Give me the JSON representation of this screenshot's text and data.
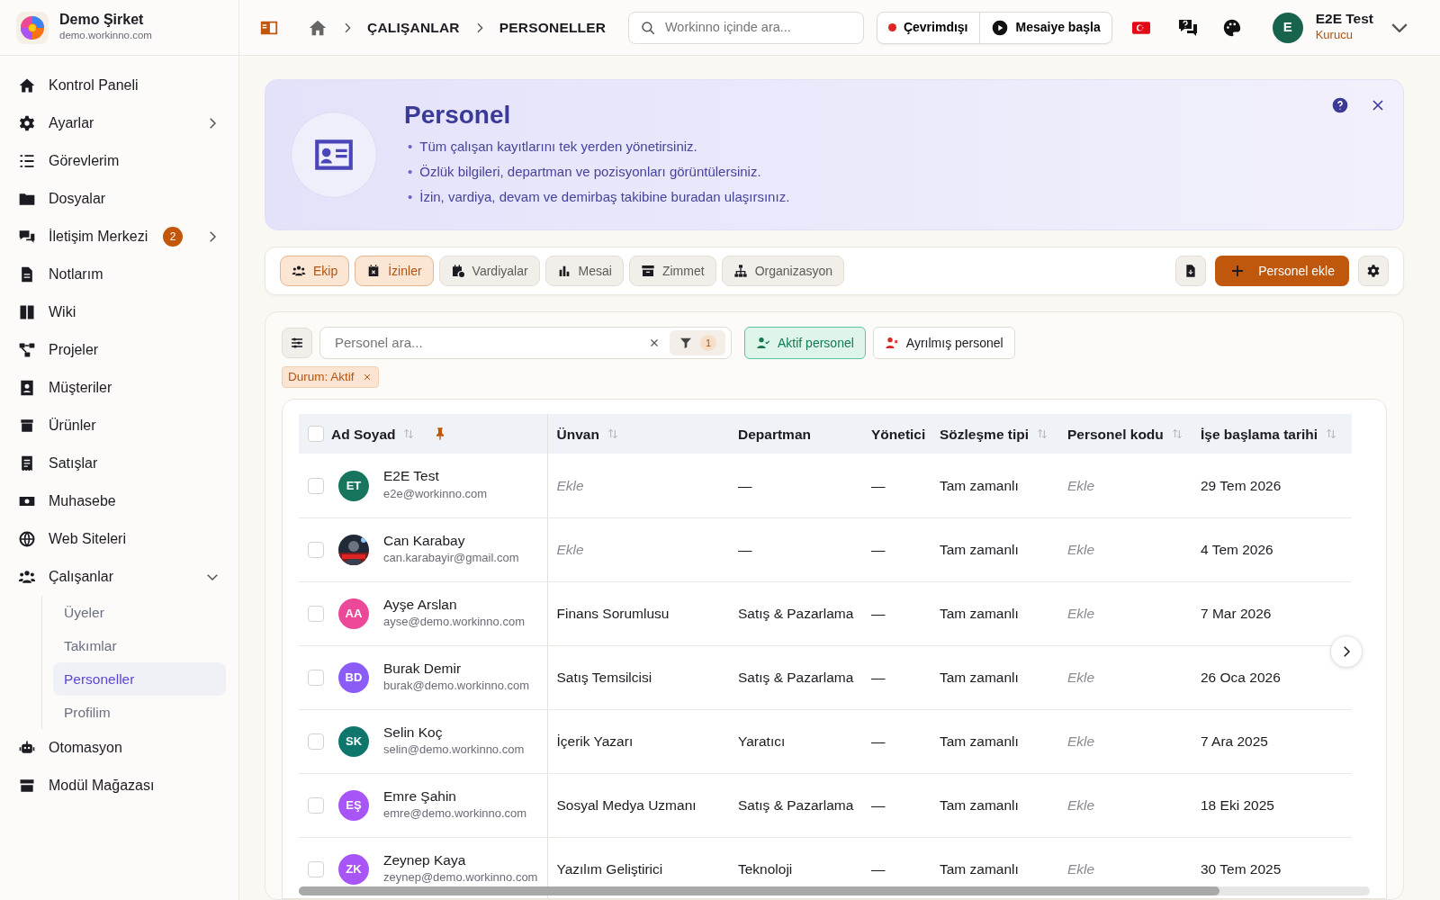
{
  "brand": {
    "name": "Demo Şirket",
    "domain": "demo.workinno.com"
  },
  "header": {
    "breadcrumb": [
      "ÇALIŞANLAR",
      "PERSONELLER"
    ],
    "search": {
      "placeholder": "Workinno içinde ara..."
    },
    "presence": {
      "label": "Çevrimdışı",
      "online": false
    },
    "shift_button": "Mesaiye başla",
    "user": {
      "initial": "E",
      "name": "E2E Test",
      "role": "Kurucu"
    }
  },
  "sidebar": {
    "items": [
      {
        "label": "Kontrol Paneli",
        "kind": "link"
      },
      {
        "label": "Ayarlar",
        "kind": "group",
        "expanded": false
      },
      {
        "label": "Görevlerim",
        "kind": "link"
      },
      {
        "label": "Dosyalar",
        "kind": "link"
      },
      {
        "label": "İletişim Merkezi",
        "kind": "group",
        "expanded": false,
        "badge": "2"
      },
      {
        "label": "Notlarım",
        "kind": "link"
      },
      {
        "label": "Wiki",
        "kind": "link"
      },
      {
        "label": "Projeler",
        "kind": "link"
      },
      {
        "label": "Müşteriler",
        "kind": "link"
      },
      {
        "label": "Ürünler",
        "kind": "link"
      },
      {
        "label": "Satışlar",
        "kind": "link"
      },
      {
        "label": "Muhasebe",
        "kind": "link"
      },
      {
        "label": "Web Siteleri",
        "kind": "link"
      },
      {
        "label": "Çalışanlar",
        "kind": "group",
        "expanded": true,
        "children": [
          {
            "label": "Üyeler",
            "selected": false
          },
          {
            "label": "Takımlar",
            "selected": false
          },
          {
            "label": "Personeller",
            "selected": true
          },
          {
            "label": "Profilim",
            "selected": false
          }
        ]
      },
      {
        "label": "Otomasyon",
        "kind": "link"
      },
      {
        "label": "Modül Mağazası",
        "kind": "link"
      }
    ]
  },
  "info_banner": {
    "title": "Personel",
    "bullets": [
      {
        "marker": "•",
        "text": "Tüm çalışan kayıtlarını tek yerden yönetirsiniz."
      },
      {
        "marker": "•",
        "text": "Özlük bilgileri, departman ve pozisyonları görüntülersiniz."
      },
      {
        "marker": "•",
        "text": "İzin, vardiya, devam ve demirbaş takibine buradan ulaşırsınız."
      }
    ]
  },
  "tabs": [
    {
      "label": "Ekip",
      "selected": true
    },
    {
      "label": "İzinler",
      "selected": true
    },
    {
      "label": "Vardiyalar",
      "selected": false
    },
    {
      "label": "Mesai",
      "selected": false
    },
    {
      "label": "Zimmet",
      "selected": false
    },
    {
      "label": "Organizasyon",
      "selected": false
    }
  ],
  "add_button": "Personel ekle",
  "filters": {
    "search": {
      "placeholder": "Personel ara..."
    },
    "filter_count": "1",
    "status_buttons": [
      {
        "label": "Aktif personel",
        "selected": true
      },
      {
        "label": "Ayrılmış personel",
        "selected": false
      }
    ],
    "chips": [
      "Durum: Aktif"
    ]
  },
  "table": {
    "select_all": {
      "checked": false
    },
    "columns": [
      {
        "label": "Ad Soyad",
        "sortable": true,
        "pinned": true
      },
      {
        "label": "Ünvan",
        "sortable": true,
        "pinned": false
      },
      {
        "label": "Departman",
        "sortable": false,
        "pinned": false
      },
      {
        "label": "Yönetici",
        "sortable": false,
        "pinned": false
      },
      {
        "label": "Sözleşme tipi",
        "sortable": true,
        "pinned": false
      },
      {
        "label": "Personel kodu",
        "sortable": true,
        "pinned": false
      },
      {
        "label": "İşe başlama tarihi",
        "sortable": true,
        "pinned": false
      }
    ],
    "rows": [
      {
        "checked": false,
        "avatar": {
          "kind": "initials",
          "text": "ET",
          "color": "#17745d"
        },
        "name": "E2E Test",
        "email": "e2e@workinno.com",
        "title": {
          "text": "Ekle",
          "empty": true
        },
        "department": "—",
        "manager": "—",
        "contract": "Tam zamanlı",
        "code": {
          "text": "Ekle",
          "empty": true
        },
        "start_date": "29 Tem 2026"
      },
      {
        "checked": false,
        "name": "Can Karabay",
        "email": "can.karabayir@gmail.com",
        "title": {
          "text": "Ekle",
          "empty": true
        },
        "department": "—",
        "manager": "—",
        "contract": "Tam zamanlı",
        "code": {
          "text": "Ekle",
          "empty": true
        },
        "start_date": "4 Tem 2026"
      },
      {
        "checked": false,
        "avatar": {
          "kind": "initials",
          "text": "AA",
          "color": "#ec4899"
        },
        "name": "Ayşe Arslan",
        "email": "ayse@demo.workinno.com",
        "title": {
          "text": "Finans Sorumlusu",
          "empty": false
        },
        "department": "Satış & Pazarlama",
        "manager": "—",
        "contract": "Tam zamanlı",
        "code": {
          "text": "Ekle",
          "empty": true
        },
        "start_date": "7 Mar 2026"
      },
      {
        "checked": false,
        "avatar": {
          "kind": "initials",
          "text": "BD",
          "color": "#8b5cf6"
        },
        "name": "Burak Demir",
        "email": "burak@demo.workinno.com",
        "title": {
          "text": "Satış Temsilcisi",
          "empty": false
        },
        "department": "Satış & Pazarlama",
        "manager": "—",
        "contract": "Tam zamanlı",
        "code": {
          "text": "Ekle",
          "empty": true
        },
        "start_date": "26 Oca 2026"
      },
      {
        "checked": false,
        "avatar": {
          "kind": "initials",
          "text": "SK",
          "color": "#0f766e"
        },
        "name": "Selin Koç",
        "email": "selin@demo.workinno.com",
        "title": {
          "text": "İçerik Yazarı",
          "empty": false
        },
        "department": "Yaratıcı",
        "manager": "—",
        "contract": "Tam zamanlı",
        "code": {
          "text": "Ekle",
          "empty": true
        },
        "start_date": "7 Ara 2025"
      },
      {
        "checked": false,
        "avatar": {
          "kind": "initials",
          "text": "EŞ",
          "color": "#a855f7"
        },
        "name": "Emre Şahin",
        "email": "emre@demo.workinno.com",
        "title": {
          "text": "Sosyal Medya Uzmanı",
          "empty": false
        },
        "department": "Satış & Pazarlama",
        "manager": "—",
        "contract": "Tam zamanlı",
        "code": {
          "text": "Ekle",
          "empty": true
        },
        "start_date": "18 Eki 2025"
      },
      {
        "checked": false,
        "avatar": {
          "kind": "initials",
          "text": "ZK",
          "color": "#a855f7"
        },
        "name": "Zeynep Kaya",
        "email": "zeynep@demo.workinno.com",
        "title": {
          "text": "Yazılım Geliştirici",
          "empty": false
        },
        "department": "Teknoloji",
        "manager": "—",
        "contract": "Tam zamanlı",
        "code": {
          "text": "Ekle",
          "empty": true
        },
        "start_date": "30 Tem 2025"
      }
    ]
  }
}
